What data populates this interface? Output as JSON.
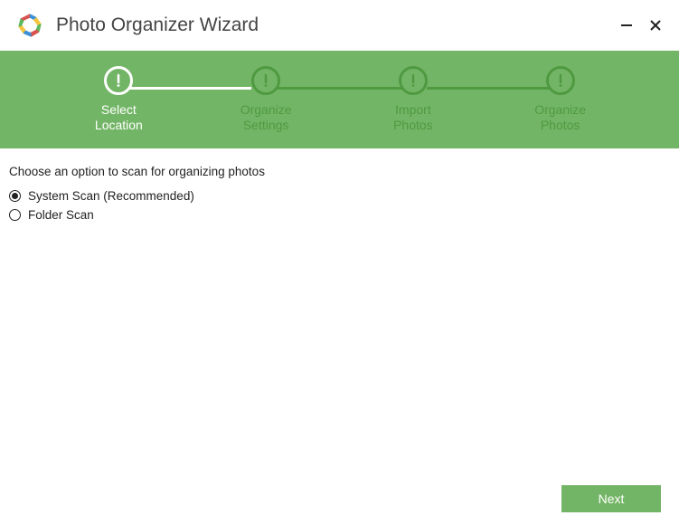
{
  "header": {
    "title": "Photo Organizer Wizard"
  },
  "steps": [
    {
      "label": "Select\nLocation",
      "active": true
    },
    {
      "label": "Organize\nSettings",
      "active": false
    },
    {
      "label": "Import\nPhotos",
      "active": false
    },
    {
      "label": "Organize\nPhotos",
      "active": false
    }
  ],
  "content": {
    "prompt": "Choose an option to scan for organizing photos",
    "options": [
      {
        "label": "System Scan (Recommended)",
        "checked": true
      },
      {
        "label": "Folder Scan",
        "checked": false
      }
    ]
  },
  "footer": {
    "next_label": "Next"
  }
}
